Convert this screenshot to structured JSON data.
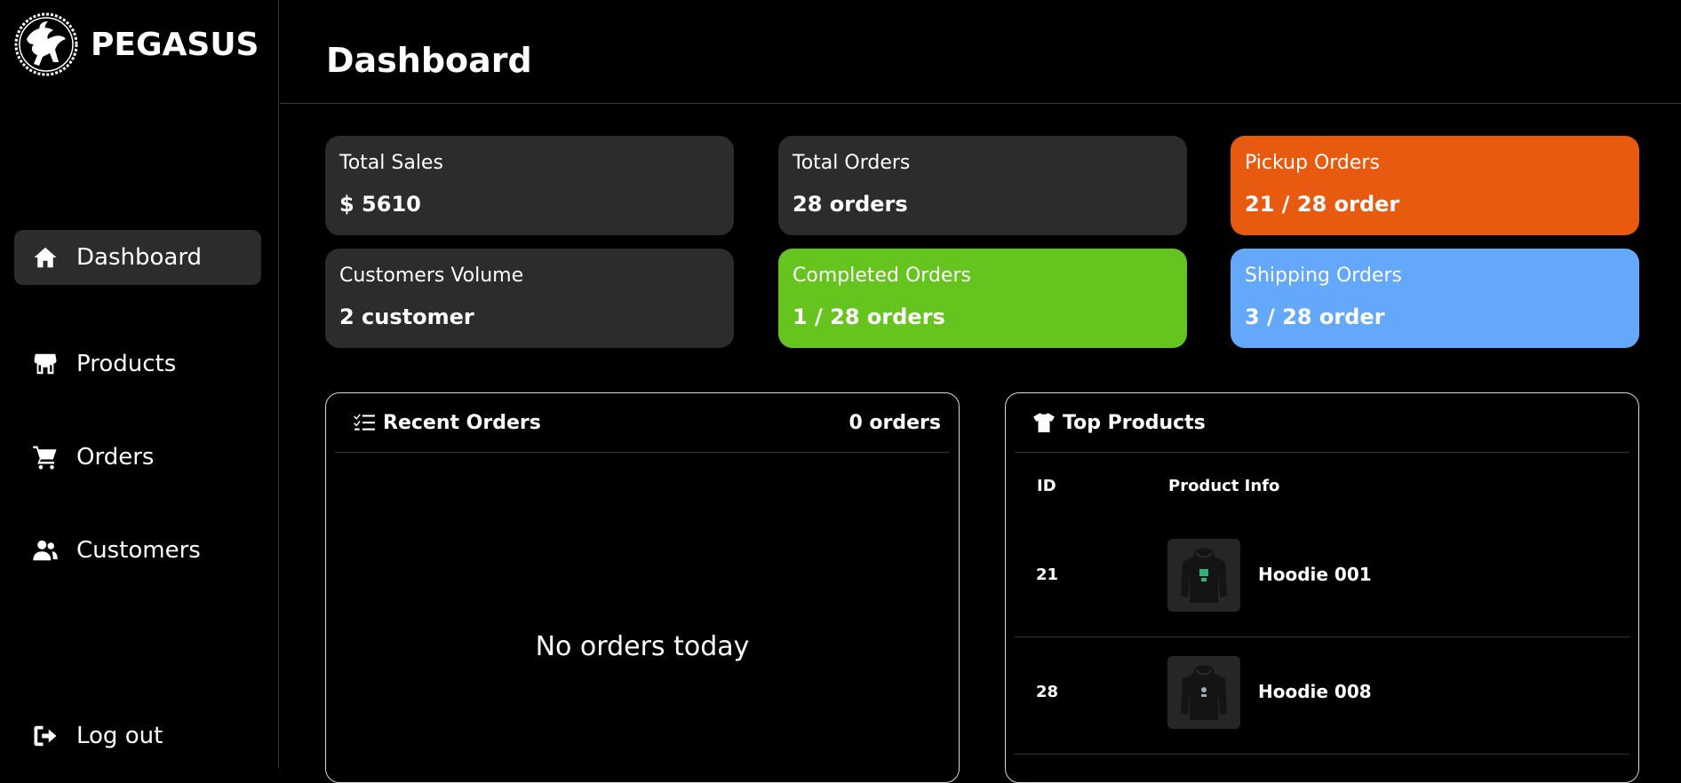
{
  "brand": {
    "name": "PEGASUS",
    "logo_icon": "pegasus-logo"
  },
  "sidebar": {
    "items": [
      {
        "label": "Dashboard",
        "icon": "home-icon",
        "active": true
      },
      {
        "label": "Products",
        "icon": "store-icon",
        "active": false
      },
      {
        "label": "Orders",
        "icon": "cart-icon",
        "active": false
      },
      {
        "label": "Customers",
        "icon": "users-icon",
        "active": false
      }
    ],
    "logout": {
      "label": "Log out",
      "icon": "logout-icon"
    }
  },
  "header": {
    "title": "Dashboard"
  },
  "stats": [
    {
      "label": "Total Sales",
      "value": "$ 5610",
      "color": "#2c2c2c"
    },
    {
      "label": "Total Orders",
      "value": "28 orders",
      "color": "#2c2c2c"
    },
    {
      "label": "Pickup Orders",
      "value": "21 / 28 order",
      "color": "#e85a10"
    },
    {
      "label": "Customers Volume",
      "value": "2 customer",
      "color": "#2c2c2c"
    },
    {
      "label": "Completed Orders",
      "value": "1 / 28 orders",
      "color": "#65c41e"
    },
    {
      "label": "Shipping Orders",
      "value": "3 / 28 order",
      "color": "#63a8fb"
    }
  ],
  "recent_orders": {
    "title": "Recent Orders",
    "count": "0 orders",
    "empty_text": "No orders today"
  },
  "top_products": {
    "title": "Top Products",
    "columns": [
      "ID",
      "Product Info"
    ],
    "rows": [
      {
        "id": "21",
        "name": "Hoodie 001"
      },
      {
        "id": "28",
        "name": "Hoodie 008"
      }
    ]
  }
}
